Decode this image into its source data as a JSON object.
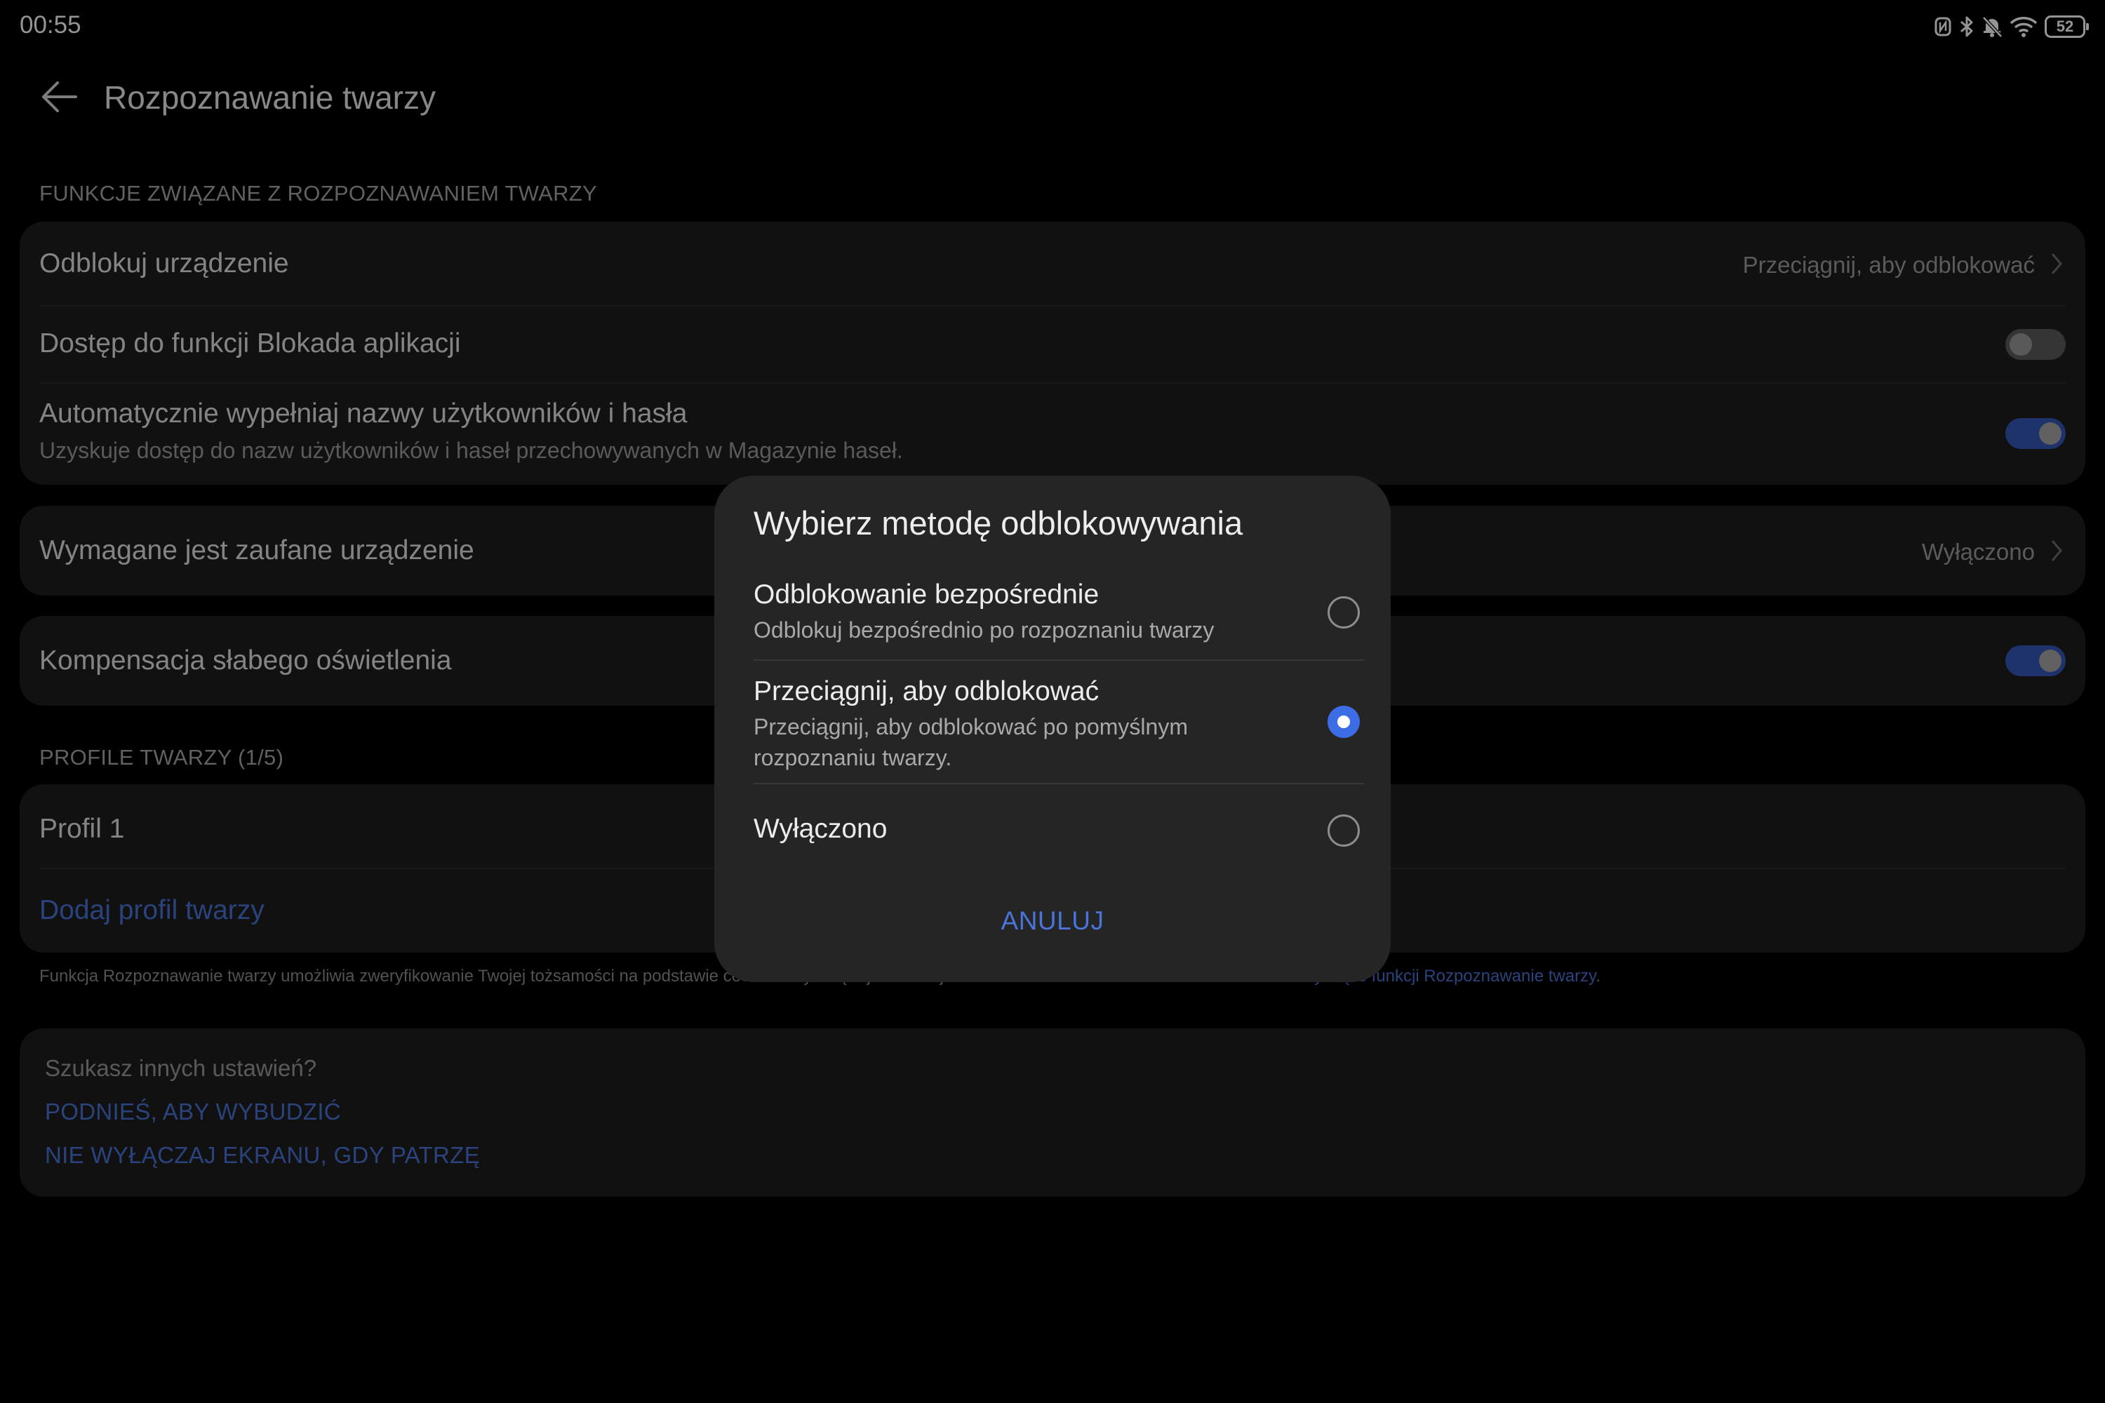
{
  "status_bar": {
    "time": "00:55",
    "battery": "52",
    "icons": [
      "nfc-icon",
      "bluetooth-icon",
      "notifications-off-icon",
      "wifi-icon",
      "battery-icon"
    ]
  },
  "header": {
    "title": "Rozpoznawanie twarzy",
    "back_icon": "back-arrow-icon"
  },
  "face_features": {
    "section_title": "FUNKCJE ZWIĄZANE Z ROZPOZNAWANIEM TWARZY",
    "unlock_device": {
      "label": "Odblokuj urządzenie",
      "value": "Przeciągnij, aby odblokować"
    },
    "app_lock": {
      "label": "Dostęp do funkcji Blokada aplikacji",
      "enabled": false
    },
    "autofill": {
      "label": "Automatycznie wypełniaj nazwy użytkowników i hasła",
      "sublabel": "Uzyskuje dostęp do nazw użytkowników i haseł przechowywanych w Magazynie haseł.",
      "enabled": true
    }
  },
  "trusted_device": {
    "label": "Wymagane jest zaufane urządzenie",
    "value": "Wyłączono"
  },
  "low_light": {
    "label": "Kompensacja słabego oświetlenia",
    "enabled": true
  },
  "profiles": {
    "section_title": "PROFILE TWARZY (1/5)",
    "items": [
      {
        "label": "Profil 1"
      }
    ],
    "add_label": "Dodaj profil twarzy"
  },
  "footnote": {
    "text": "Funkcja Rozpoznawanie twarzy umożliwia zweryfikowanie Twojej tożsamości na podstawie cech twarzy. Więcej informacji można znaleźć w dokumencie ",
    "link": "Oświadczenie dotyczące funkcji Rozpoznawanie twarzy",
    "end": "."
  },
  "other_settings": {
    "label": "Szukasz innych ustawień?",
    "links": [
      "PODNIEŚ, ABY WYBUDZIĆ",
      "NIE WYŁĄCZAJ EKRANU, GDY PATRZĘ"
    ]
  },
  "dialog": {
    "title": "Wybierz metodę odblokowywania",
    "options": [
      {
        "title": "Odblokowanie bezpośrednie",
        "description": "Odblokuj bezpośrednio po rozpoznaniu twarzy",
        "selected": false
      },
      {
        "title": "Przeciągnij, aby odblokować",
        "description": "Przeciągnij, aby odblokować po pomyślnym rozpoznaniu twarzy.",
        "selected": true
      },
      {
        "title": "Wyłączono",
        "description": "",
        "selected": false
      }
    ],
    "cancel_label": "ANULUJ"
  },
  "colors": {
    "background": "#000000",
    "card": "#1e1e1f",
    "dialog": "#252526",
    "accent": "#3d6de6",
    "link": "#4a74d8",
    "toggle_on": "#3556b8"
  }
}
